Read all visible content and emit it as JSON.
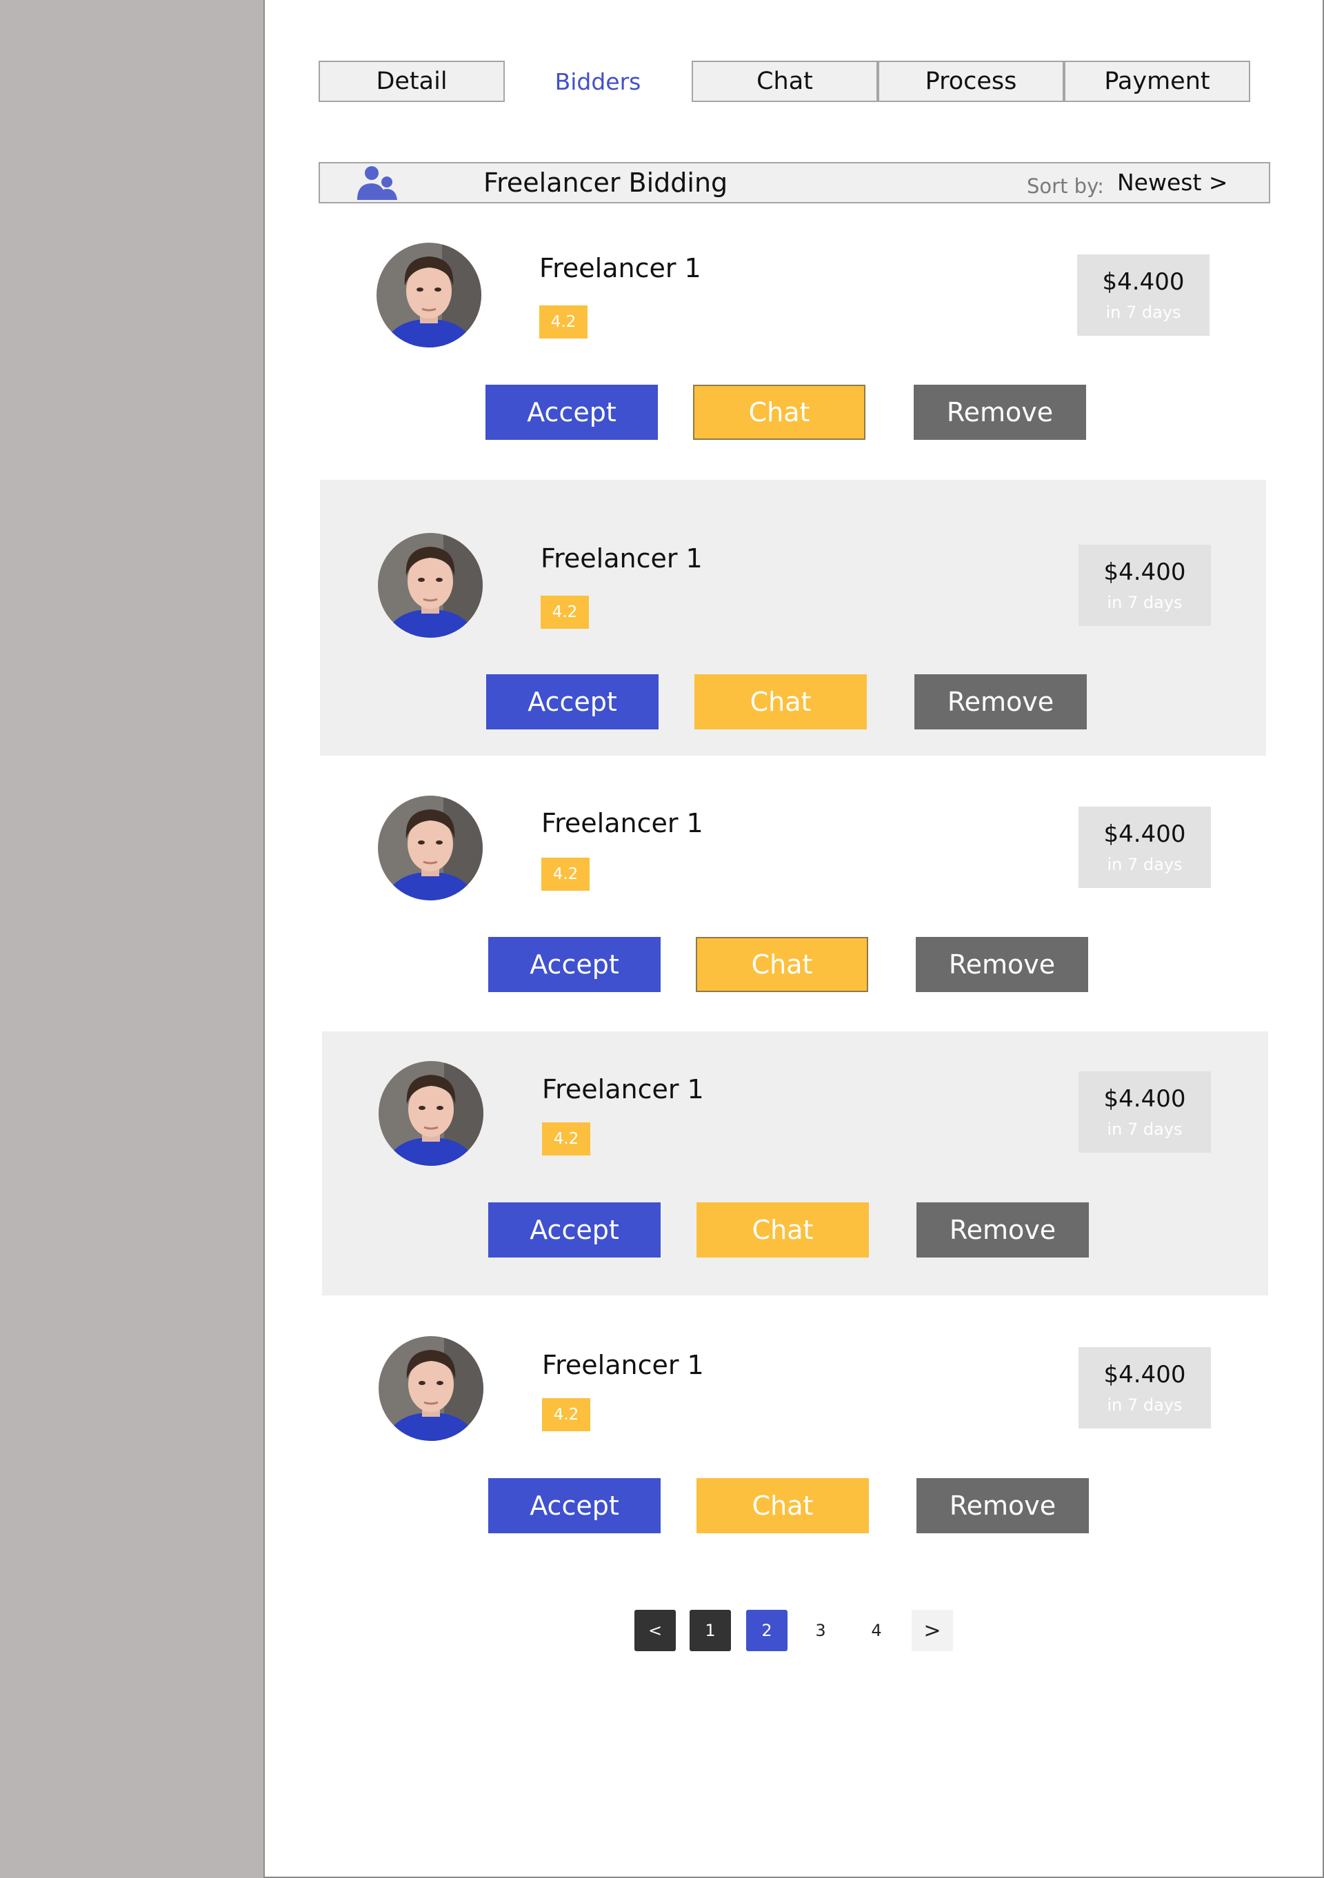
{
  "tabs": [
    {
      "label": "Detail"
    },
    {
      "label": "Bidders"
    },
    {
      "label": "Chat"
    },
    {
      "label": "Process"
    },
    {
      "label": "Payment"
    }
  ],
  "header": {
    "icon": "people-icon",
    "title": "Freelancer Bidding",
    "sort_label": "Sort by:",
    "sort_value": "Newest >"
  },
  "bids": [
    {
      "name": "Freelancer 1",
      "rating": "4.2",
      "price": "$4.400",
      "duration": "in 7 days",
      "accept_label": "Accept",
      "chat_label": "Chat",
      "remove_label": "Remove"
    },
    {
      "name": "Freelancer 1",
      "rating": "4.2",
      "price": "$4.400",
      "duration": "in 7 days",
      "accept_label": "Accept",
      "chat_label": "Chat",
      "remove_label": "Remove"
    },
    {
      "name": "Freelancer 1",
      "rating": "4.2",
      "price": "$4.400",
      "duration": "in 7 days",
      "accept_label": "Accept",
      "chat_label": "Chat",
      "remove_label": "Remove"
    },
    {
      "name": "Freelancer 1",
      "rating": "4.2",
      "price": "$4.400",
      "duration": "in 7 days",
      "accept_label": "Accept",
      "chat_label": "Chat",
      "remove_label": "Remove"
    },
    {
      "name": "Freelancer 1",
      "rating": "4.2",
      "price": "$4.400",
      "duration": "in 7 days",
      "accept_label": "Accept",
      "chat_label": "Chat",
      "remove_label": "Remove"
    }
  ],
  "pagination": {
    "prev": "<",
    "pages": [
      "1",
      "2",
      "3",
      "4"
    ],
    "current": "2",
    "next": ">"
  },
  "colors": {
    "accent": "#3f51ce",
    "rating": "#fcc03e",
    "remove": "#6b6b6b",
    "sidebar": "#bab5b5"
  }
}
